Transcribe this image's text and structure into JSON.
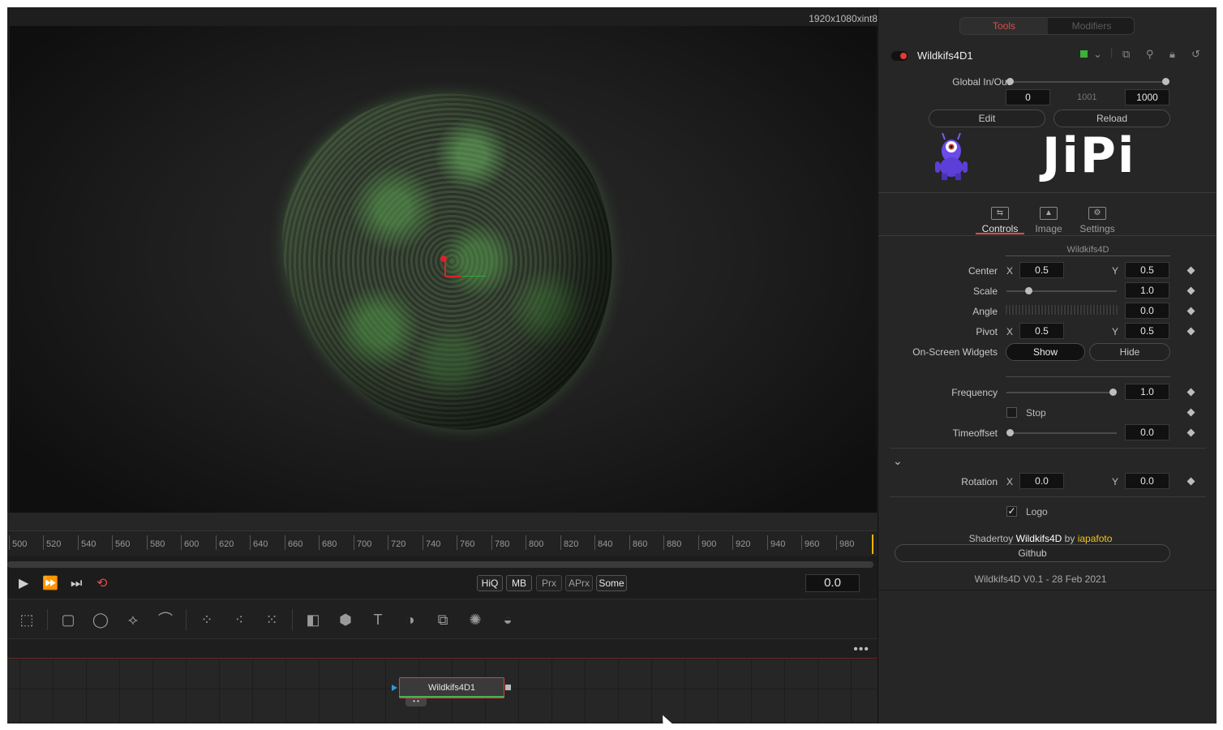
{
  "viewer": {
    "resolution": "1920x1080xint8"
  },
  "ruler": {
    "ticks": [
      "500",
      "520",
      "540",
      "560",
      "580",
      "600",
      "620",
      "640",
      "660",
      "680",
      "700",
      "720",
      "740",
      "760",
      "780",
      "800",
      "820",
      "840",
      "860",
      "880",
      "900",
      "920",
      "940",
      "960",
      "980"
    ]
  },
  "transport": {
    "quality_buttons": [
      "HiQ",
      "MB",
      "Prx",
      "APrx",
      "Some"
    ],
    "current_time": "0.0"
  },
  "node": {
    "name": "Wildkifs4D1"
  },
  "inspector": {
    "tabs": [
      "Tools",
      "Modifiers"
    ],
    "active_tab": "Tools",
    "tool_name": "Wildkifs4D1",
    "global_inout_label": "Global In/Out",
    "global_in": "0",
    "global_mid": "1001",
    "global_out": "1000",
    "edit_label": "Edit",
    "reload_label": "Reload",
    "logo_text": "JiPi",
    "subtabs": [
      "Controls",
      "Image",
      "Settings"
    ],
    "active_subtab": "Controls",
    "group_title": "Wildkifs4D",
    "center_label": "Center",
    "center_x": "0.5",
    "center_y": "0.5",
    "scale_label": "Scale",
    "scale_value": "1.0",
    "angle_label": "Angle",
    "angle_value": "0.0",
    "pivot_label": "Pivot",
    "pivot_x": "0.5",
    "pivot_y": "0.5",
    "widgets_label": "On-Screen Widgets",
    "show_label": "Show",
    "hide_label": "Hide",
    "frequency_label": "Frequency",
    "frequency_value": "1.0",
    "stop_label": "Stop",
    "timeoffset_label": "Timeoffset",
    "timeoffset_value": "0.0",
    "rotation_label": "Rotation",
    "rotation_x": "0.0",
    "rotation_y": "0.0",
    "logo_label": "Logo",
    "logo_checked": true,
    "credit_prefix": "Shadertoy",
    "credit_work": "Wildkifs4D",
    "credit_by": "by",
    "credit_author": "iapafoto",
    "github_label": "Github",
    "version": "Wildkifs4D V0.1 - 28 Feb 2021",
    "x_letter": "X",
    "y_letter": "Y"
  },
  "colors": {
    "accent_red": "#e44a4a",
    "node_green": "#4caf50",
    "author_yellow": "#f5c518"
  }
}
